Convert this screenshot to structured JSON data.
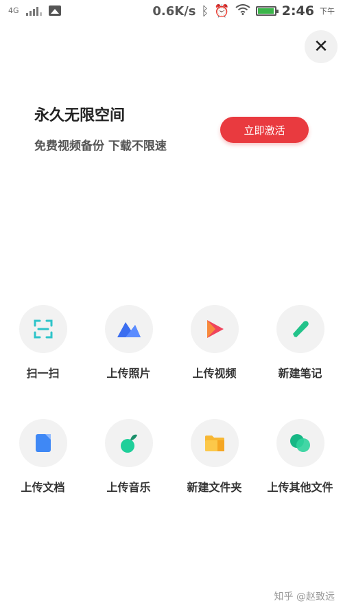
{
  "status_bar": {
    "network": "4G",
    "speed": "0.6K/s",
    "time": "2:46",
    "ampm": "下午",
    "battery_level": 0.95,
    "battery_color": "#3bb54a"
  },
  "close_button": {
    "icon": "close-icon",
    "label": "✕"
  },
  "promo": {
    "title": "永久无限空间",
    "subtitle": "免费视频备份 下载不限速",
    "button_label": "立即激活",
    "button_color": "#e93a3f"
  },
  "actions": [
    {
      "label": "扫一扫",
      "icon": "scan-icon"
    },
    {
      "label": "上传照片",
      "icon": "photo-icon"
    },
    {
      "label": "上传视频",
      "icon": "video-icon"
    },
    {
      "label": "新建笔记",
      "icon": "note-icon"
    },
    {
      "label": "上传文档",
      "icon": "document-icon"
    },
    {
      "label": "上传音乐",
      "icon": "music-icon"
    },
    {
      "label": "新建文件夹",
      "icon": "folder-icon"
    },
    {
      "label": "上传其他文件",
      "icon": "other-files-icon"
    }
  ],
  "watermark": "知乎 @赵致远"
}
